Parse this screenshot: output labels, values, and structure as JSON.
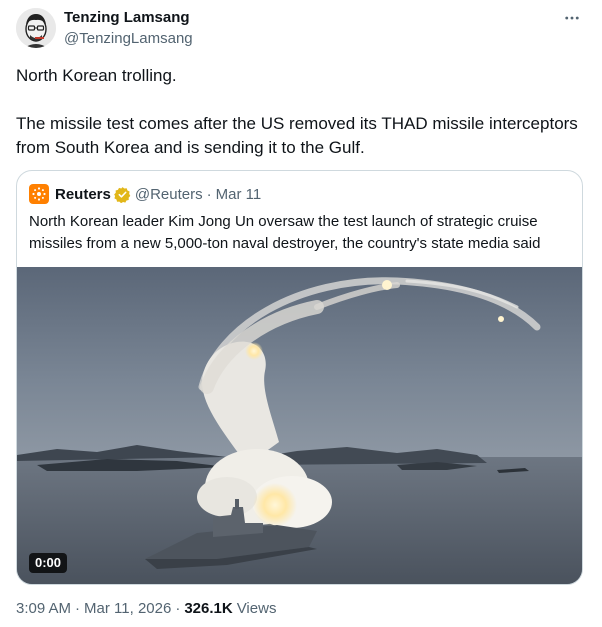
{
  "author": {
    "name": "Tenzing Lamsang",
    "handle": "@TenzingLamsang"
  },
  "tweet": {
    "line1": "North Korean trolling.",
    "line2": "The missile test comes after the US removed its THAD missile interceptors from South Korea and is sending it to the Gulf."
  },
  "quote": {
    "name": "Reuters",
    "handle": "@Reuters",
    "dot": "·",
    "date": "Mar 11",
    "text": "North Korean leader Kim Jong Un oversaw the test launch of strategic cruise missiles from a new 5,000-ton naval destroyer, the country's state media said",
    "video_time": "0:00"
  },
  "meta": {
    "time": "3:09 AM",
    "sep1": "·",
    "date": "Mar 11, 2026",
    "sep2": "·",
    "views_count": "326.1K",
    "views_label": "Views"
  },
  "colors": {
    "text": "#0f1419",
    "secondary": "#536471",
    "border": "#cfd9de",
    "verified": "#e2b719",
    "reuters": "#ff8000"
  },
  "icons": [
    "more-icon",
    "verified-icon",
    "reuters-logo"
  ]
}
